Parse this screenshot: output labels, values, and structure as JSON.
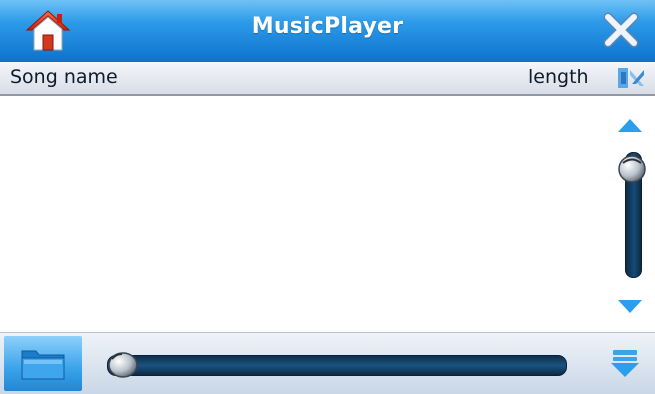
{
  "titlebar": {
    "title": "MusicPlayer",
    "home_icon": "home-icon",
    "close_icon": "close-icon"
  },
  "header": {
    "song_name_label": "Song name",
    "length_label": "length",
    "sort_icon": "sort-icon"
  },
  "list": {
    "items": []
  },
  "scroll": {
    "up_icon": "triangle-up-icon",
    "down_icon": "triangle-down-icon",
    "position": 0
  },
  "bottombar": {
    "folder_icon": "folder-icon",
    "progress": 0,
    "menu_icon": "collapse-down-icon"
  },
  "colors": {
    "titlebar": "#1f86dd",
    "accent": "#2aa0ec",
    "track": "#174a76"
  }
}
